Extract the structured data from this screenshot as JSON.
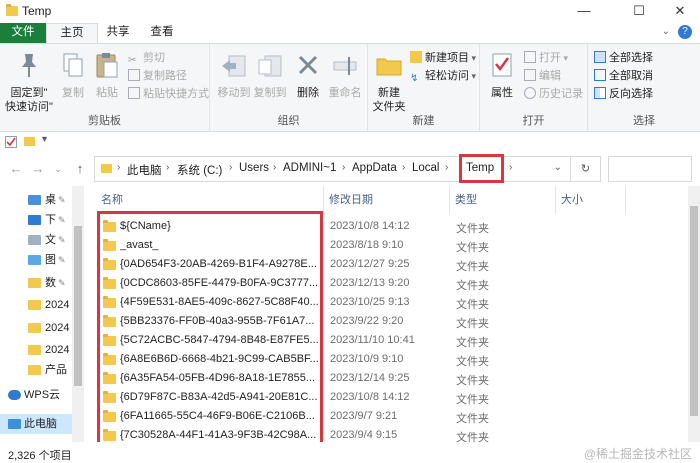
{
  "window": {
    "title": "Temp",
    "minimize": "—",
    "maximize": "☐",
    "close": "✕"
  },
  "tabs": [
    "文件",
    "主页",
    "共享",
    "查看"
  ],
  "ribbon": {
    "clipboard": {
      "label": "剪贴板",
      "pin": "固定到\"\n快速访问\"",
      "copy": "复制",
      "paste": "粘贴",
      "cut": "剪切",
      "copy_path": "复制路径",
      "paste_shortcut": "粘贴快捷方式"
    },
    "organize": {
      "label": "组织",
      "move_to": "移动到",
      "copy_to": "复制到",
      "delete": "删除",
      "rename": "重命名"
    },
    "new": {
      "label": "新建",
      "new_folder": "新建\n文件夹",
      "new_item": "新建项目",
      "easy_access": "轻松访问"
    },
    "open": {
      "label": "打开",
      "properties": "属性",
      "open": "打开",
      "edit": "编辑",
      "history": "历史记录"
    },
    "select": {
      "label": "选择",
      "select_all": "全部选择",
      "select_none": "全部取消",
      "invert": "反向选择"
    }
  },
  "address": {
    "crumbs": [
      "此电脑",
      "系统 (C:)",
      "Users",
      "ADMINI~1",
      "AppData",
      "Local",
      "Temp"
    ]
  },
  "nav": {
    "items": [
      {
        "label": "桌",
        "pinned": true
      },
      {
        "label": "下",
        "pinned": true
      },
      {
        "label": "文",
        "pinned": true
      },
      {
        "label": "图",
        "pinned": true
      },
      {
        "label": "数",
        "pinned": true
      },
      {
        "label": "2024",
        "pinned": false
      },
      {
        "label": "2024",
        "pinned": false
      },
      {
        "label": "2024",
        "pinned": false
      },
      {
        "label": "产品",
        "pinned": false
      },
      {
        "label": "WPS云",
        "pinned": false
      },
      {
        "label": "此电脑",
        "pinned": false
      }
    ],
    "pin_glyph": "📌"
  },
  "columns": {
    "name": "名称",
    "date": "修改日期",
    "type": "类型",
    "size": "大小"
  },
  "files": [
    {
      "name": "${CName}",
      "date": "2023/10/8 14:12",
      "type": "文件夹"
    },
    {
      "name": "_avast_",
      "date": "2023/8/18 9:10",
      "type": "文件夹"
    },
    {
      "name": "{0AD654F3-20AB-4269-B1F4-A9278E...",
      "date": "2023/12/27 9:25",
      "type": "文件夹"
    },
    {
      "name": "{0CDC8603-85FE-4479-B0FA-9C3777...",
      "date": "2023/12/13 9:20",
      "type": "文件夹"
    },
    {
      "name": "{4F59E531-8AE5-409c-8627-5C88F40...",
      "date": "2023/10/25 9:13",
      "type": "文件夹"
    },
    {
      "name": "{5BB23376-FF0B-40a3-955B-7F61A7...",
      "date": "2023/9/22 9:20",
      "type": "文件夹"
    },
    {
      "name": "{5C72ACBC-5847-4794-8B48-E87FE5...",
      "date": "2023/11/10 10:41",
      "type": "文件夹"
    },
    {
      "name": "{6A8E6B6D-6668-4b21-9C99-CAB5BF...",
      "date": "2023/10/9 9:10",
      "type": "文件夹"
    },
    {
      "name": "{6A35FA54-05FB-4D96-8A18-1E7855...",
      "date": "2023/12/14 9:25",
      "type": "文件夹"
    },
    {
      "name": "{6D79F87C-B83A-42d5-A941-20E81C...",
      "date": "2023/10/8 14:12",
      "type": "文件夹"
    },
    {
      "name": "{6FA11665-55C4-46F9-B06E-C2106B...",
      "date": "2023/9/7 9:21",
      "type": "文件夹"
    },
    {
      "name": "{7C30528A-44F1-41A3-9F3B-42C98A...",
      "date": "2023/9/4 9:15",
      "type": "文件夹"
    }
  ],
  "status": {
    "count": "2,326 个项目"
  },
  "watermark": "@稀土掘金技术社区",
  "colors": {
    "file_tab": "#1b7f3b",
    "highlight": "#d9363e",
    "folder": "#f2c94c"
  }
}
